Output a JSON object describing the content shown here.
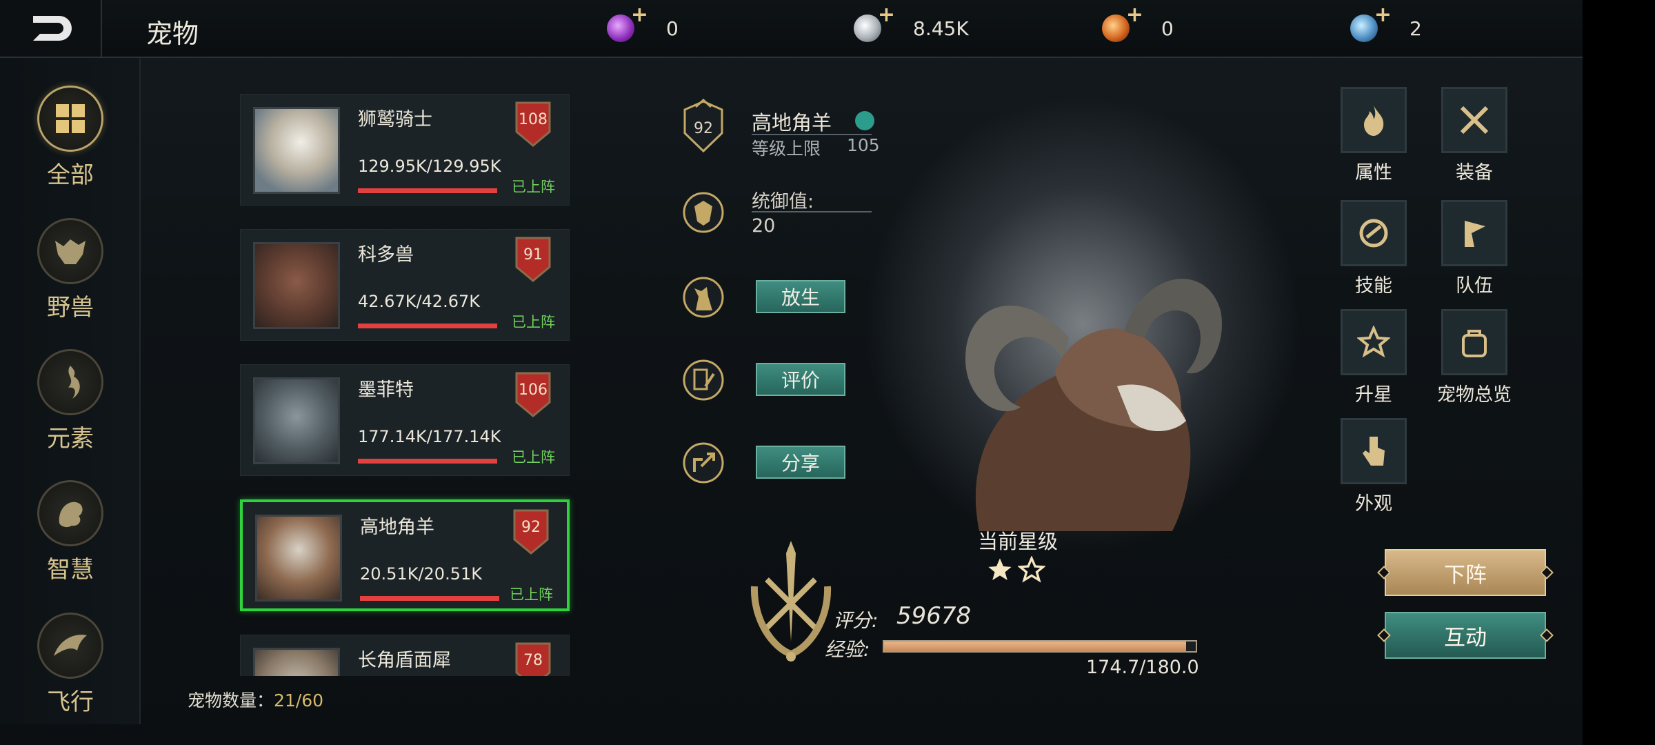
{
  "header": {
    "title": "宠物",
    "back_icon": "back-arrow-icon",
    "currencies": [
      {
        "name": "purple-gem-icon",
        "amount": "0",
        "color": "#b04ad6"
      },
      {
        "name": "silver-coin-icon",
        "amount": "8.45K",
        "color": "#c9cfd4"
      },
      {
        "name": "orange-gem-icon",
        "amount": "0",
        "color": "#e0762f"
      },
      {
        "name": "blue-crystal-icon",
        "amount": "2",
        "color": "#6fa9d8"
      }
    ]
  },
  "categories": [
    {
      "label": "全部",
      "icon": "grid-icon",
      "active": true
    },
    {
      "label": "野兽",
      "icon": "beast-icon",
      "active": false
    },
    {
      "label": "元素",
      "icon": "element-icon",
      "active": false
    },
    {
      "label": "智慧",
      "icon": "wisdom-icon",
      "active": false
    },
    {
      "label": "飞行",
      "icon": "flying-icon",
      "active": false
    }
  ],
  "pets": [
    {
      "name": "狮鹫骑士",
      "hp": "129.95K/129.95K",
      "level": "108",
      "status": "已上阵",
      "hp_fraction": 1.0
    },
    {
      "name": "科多兽",
      "hp": "42.67K/42.67K",
      "level": "91",
      "status": "已上阵",
      "hp_fraction": 1.0
    },
    {
      "name": "墨菲特",
      "hp": "177.14K/177.14K",
      "level": "106",
      "status": "已上阵",
      "hp_fraction": 1.0
    },
    {
      "name": "高地角羊",
      "hp": "20.51K/20.51K",
      "level": "92",
      "status": "已上阵",
      "hp_fraction": 1.0,
      "selected": true
    },
    {
      "name": "长角盾面犀",
      "hp": "",
      "level": "78",
      "status": "",
      "hp_fraction": 1.0
    }
  ],
  "pet_count": {
    "label": "宠物数量：",
    "value": "21/60"
  },
  "detail": {
    "level_badge": "92",
    "name": "高地角羊",
    "level_cap_label": "等级上限",
    "level_cap_value": "105",
    "command_label": "统御值:",
    "command_value": "20",
    "release_label": "放生",
    "review_label": "评价",
    "share_label": "分享",
    "star_label": "当前星级",
    "stars_filled": 1,
    "stars_total": 2,
    "score_label": "评分:",
    "score_value": "59678",
    "exp_label": "经验:",
    "exp_text": "174.7/180.0",
    "exp_fraction": 0.97
  },
  "functions": [
    {
      "label": "属性",
      "icon": "flame-icon"
    },
    {
      "label": "装备",
      "icon": "crossed-swords-icon"
    },
    {
      "label": "技能",
      "icon": "claw-icon"
    },
    {
      "label": "队伍",
      "icon": "flag-icon"
    },
    {
      "label": "升星",
      "icon": "star-badge-icon"
    },
    {
      "label": "宠物总览",
      "icon": "backpack-icon"
    },
    {
      "label": "外观",
      "icon": "hand-pointer-icon"
    }
  ],
  "buttons": {
    "remove_label": "下阵",
    "interact_label": "互动"
  }
}
